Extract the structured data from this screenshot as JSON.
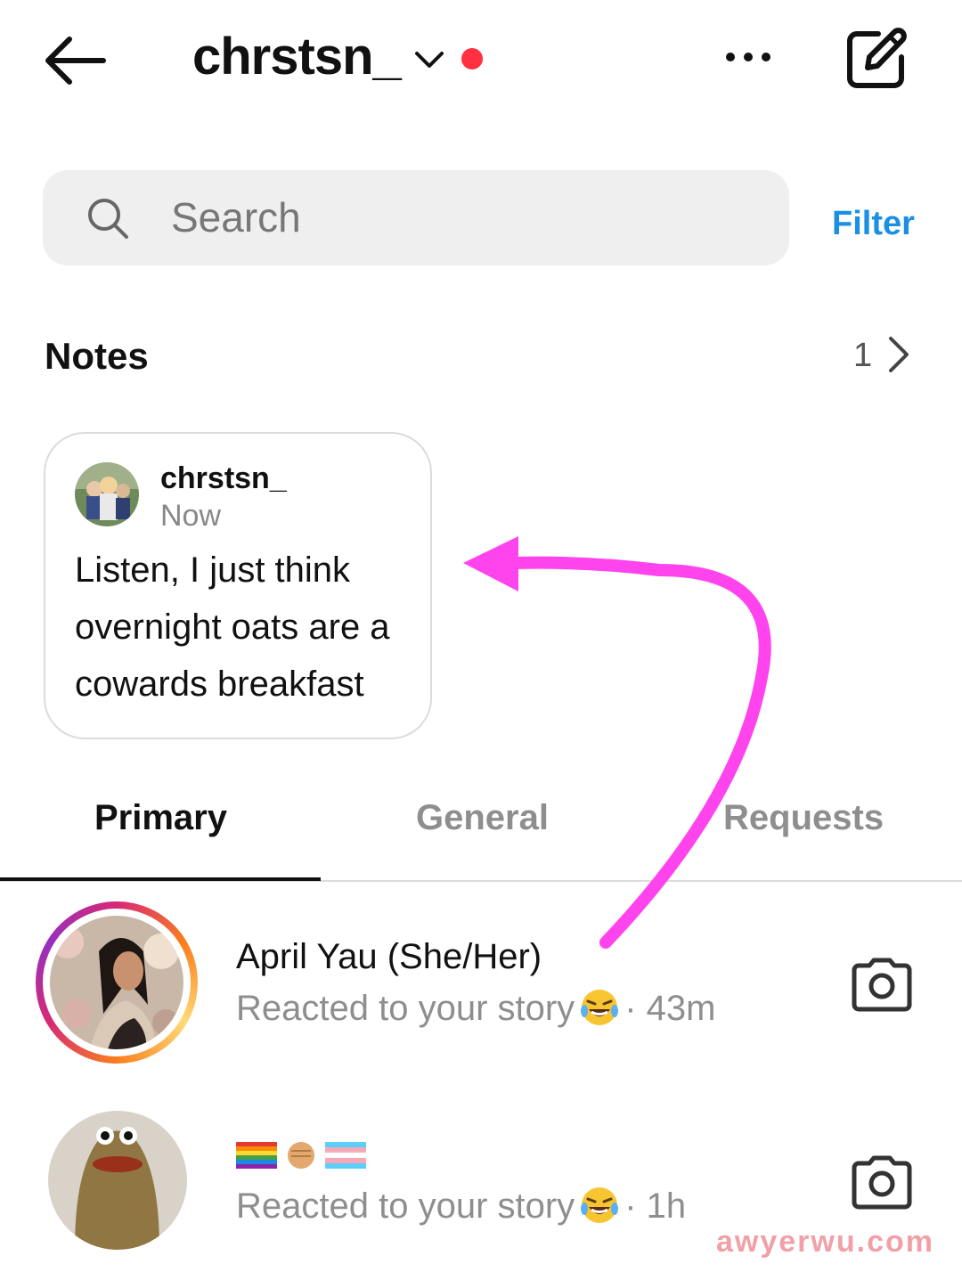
{
  "header": {
    "username": "chrstsn_",
    "icons": {
      "back": "arrow-left-icon",
      "dropdown": "chevron-down-icon",
      "more": "more-horizontal-icon",
      "compose": "compose-icon"
    }
  },
  "search": {
    "placeholder": "Search",
    "filter_label": "Filter"
  },
  "notes": {
    "title": "Notes",
    "count": "1",
    "card": {
      "user": "chrstsn_",
      "time": "Now",
      "text": "Listen, I just think overnight oats are a cowards breakfast"
    }
  },
  "tabs": [
    {
      "label": "Primary",
      "active": true
    },
    {
      "label": "General",
      "active": false
    },
    {
      "label": "Requests",
      "active": false
    }
  ],
  "threads": [
    {
      "name": "April Yau (She/Her)",
      "sub": "Reacted to your story",
      "time": "· 43m",
      "emoji": "laughing-tears-emoji",
      "has_story_ring": true
    },
    {
      "name_emoji": [
        "rainbow-flag-emoji",
        "raised-fist-emoji",
        "transgender-flag-emoji"
      ],
      "sub": "Reacted to your story",
      "time": "· 1h",
      "emoji": "laughing-tears-emoji",
      "has_story_ring": false
    }
  ],
  "watermark": "awyerwu.com",
  "colors": {
    "accent_blue": "#1a8fe3",
    "unread_dot": "#ff3040",
    "annotation_arrow": "#ff44ee"
  }
}
